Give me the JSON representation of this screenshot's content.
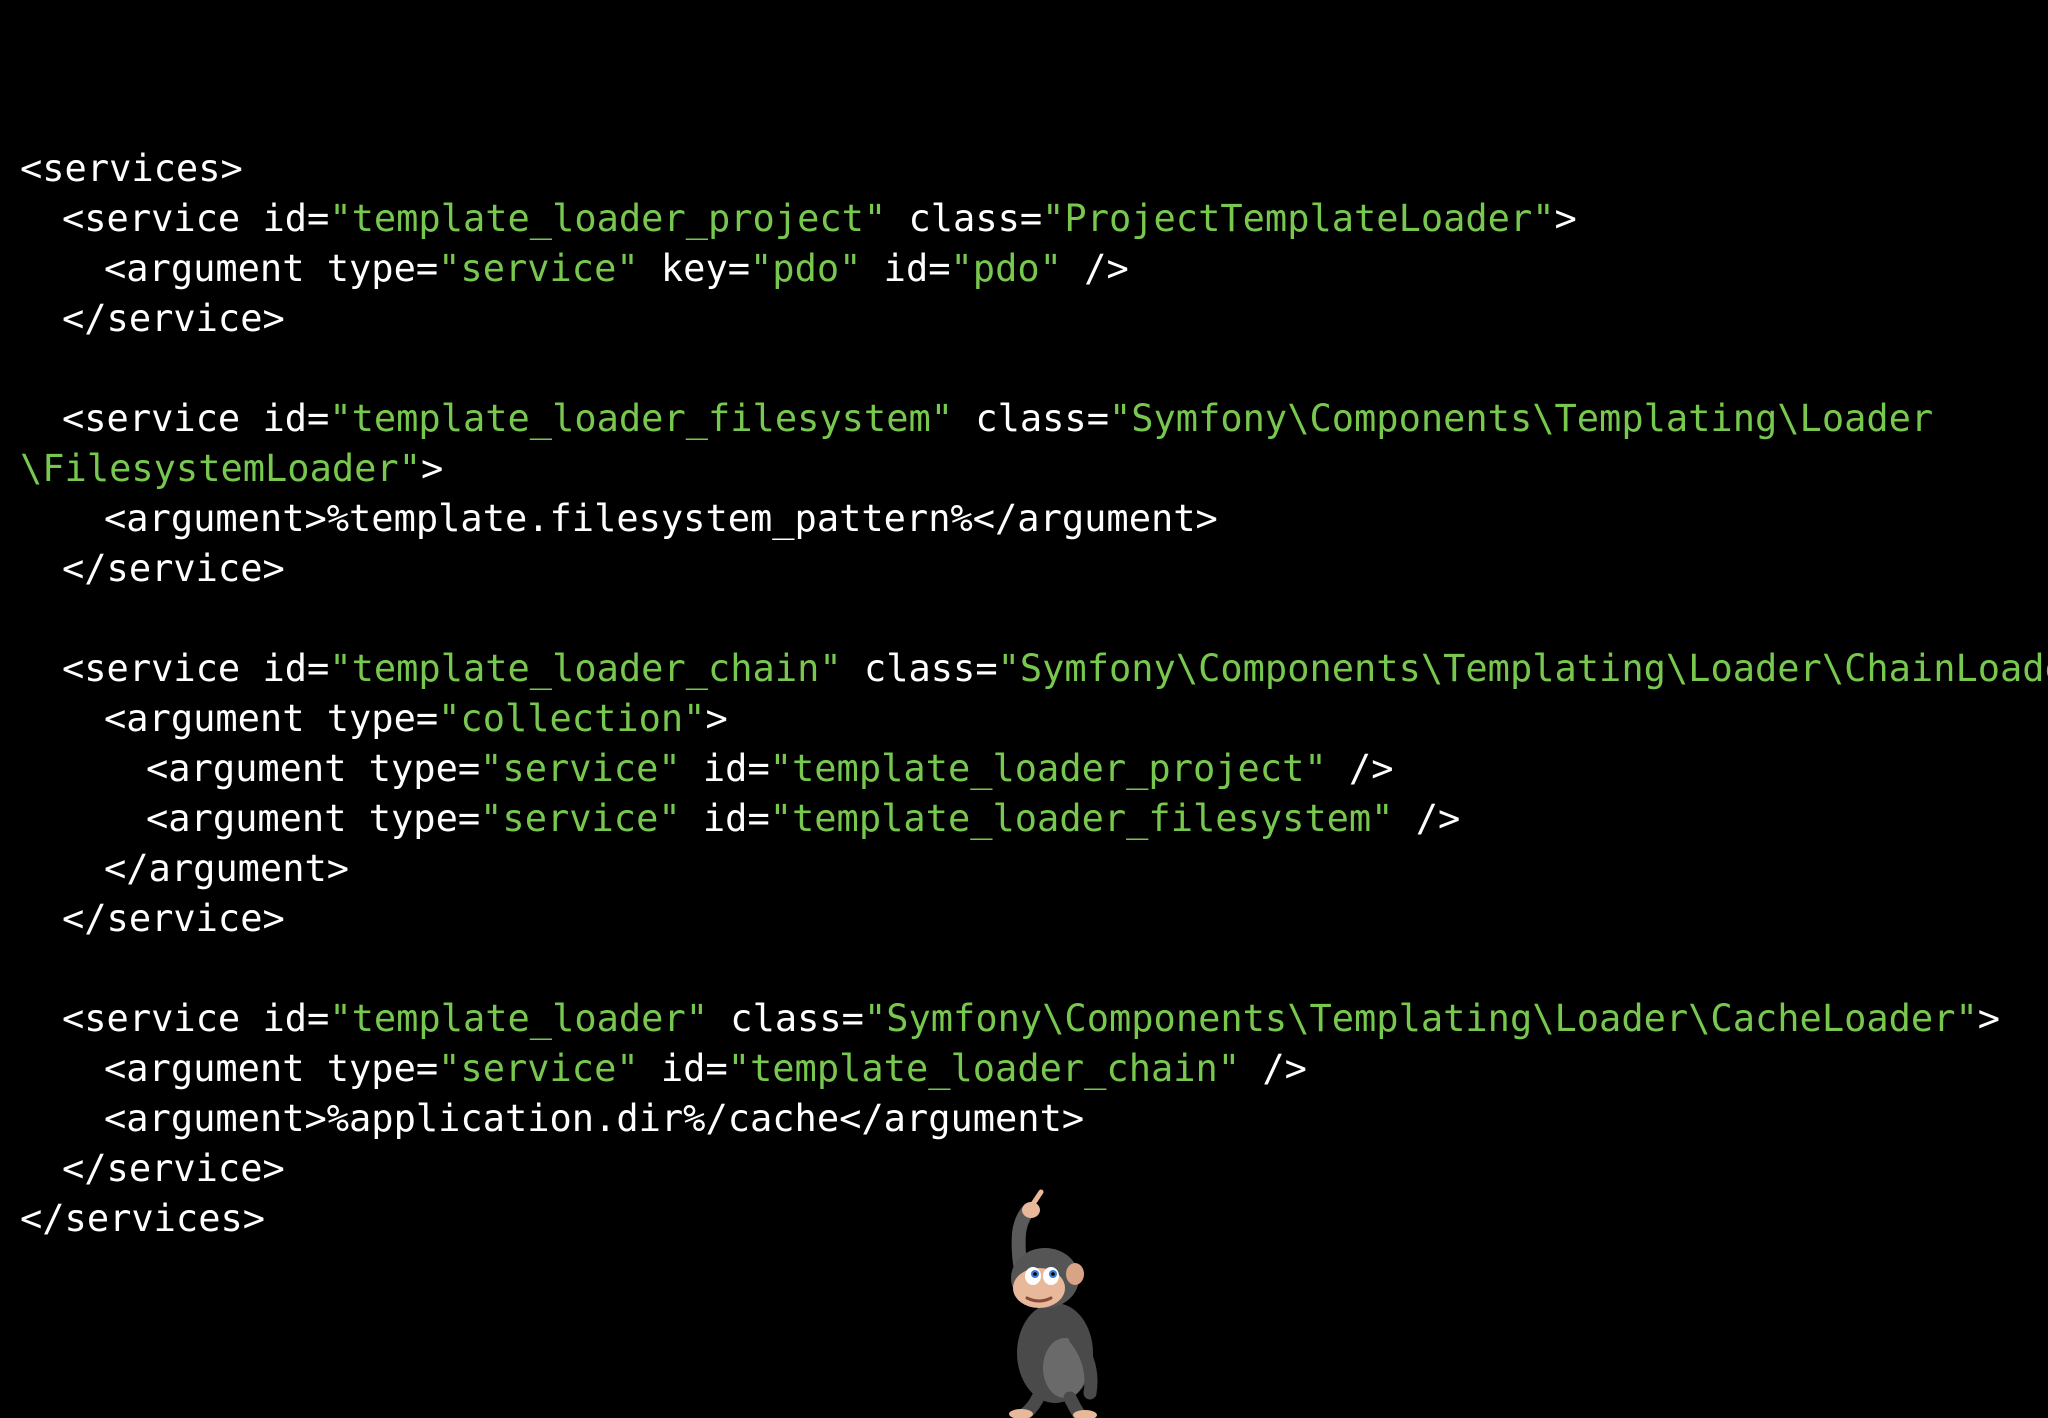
{
  "code_lines": [
    {
      "indent": 0,
      "segments": [
        {
          "t": "<services>",
          "k": "tag"
        }
      ]
    },
    {
      "indent": 1,
      "segments": [
        {
          "t": "<service id=",
          "k": "tag"
        },
        {
          "t": "\"template_loader_project\"",
          "k": "str"
        },
        {
          "t": " class=",
          "k": "tag"
        },
        {
          "t": "\"ProjectTemplateLoader\"",
          "k": "str"
        },
        {
          "t": ">",
          "k": "tag"
        }
      ]
    },
    {
      "indent": 2,
      "segments": [
        {
          "t": "<argument type=",
          "k": "tag"
        },
        {
          "t": "\"service\"",
          "k": "str"
        },
        {
          "t": " key=",
          "k": "tag"
        },
        {
          "t": "\"pdo\"",
          "k": "str"
        },
        {
          "t": " id=",
          "k": "tag"
        },
        {
          "t": "\"pdo\"",
          "k": "str"
        },
        {
          "t": " />",
          "k": "tag"
        }
      ]
    },
    {
      "indent": 1,
      "segments": [
        {
          "t": "</service>",
          "k": "tag"
        }
      ]
    },
    {
      "indent": 0,
      "segments": []
    },
    {
      "indent": 1,
      "segments": [
        {
          "t": "<service id=",
          "k": "tag"
        },
        {
          "t": "\"template_loader_filesystem\"",
          "k": "str"
        },
        {
          "t": " class=",
          "k": "tag"
        },
        {
          "t": "\"Symfony\\Components\\Templating\\Loader",
          "k": "str"
        }
      ]
    },
    {
      "indent": 0,
      "segments": [
        {
          "t": "\\FilesystemLoader\"",
          "k": "str"
        },
        {
          "t": ">",
          "k": "tag"
        }
      ]
    },
    {
      "indent": 2,
      "segments": [
        {
          "t": "<argument>%template.filesystem_pattern%</argument>",
          "k": "tag"
        }
      ]
    },
    {
      "indent": 1,
      "segments": [
        {
          "t": "</service>",
          "k": "tag"
        }
      ]
    },
    {
      "indent": 0,
      "segments": []
    },
    {
      "indent": 1,
      "segments": [
        {
          "t": "<service id=",
          "k": "tag"
        },
        {
          "t": "\"template_loader_chain\"",
          "k": "str"
        },
        {
          "t": " class=",
          "k": "tag"
        },
        {
          "t": "\"Symfony\\Components\\Templating\\Loader\\ChainLoader\"",
          "k": "str"
        },
        {
          "t": ">",
          "k": "tag"
        }
      ]
    },
    {
      "indent": 2,
      "segments": [
        {
          "t": "<argument type=",
          "k": "tag"
        },
        {
          "t": "\"collection\"",
          "k": "str"
        },
        {
          "t": ">",
          "k": "tag"
        }
      ]
    },
    {
      "indent": 3,
      "segments": [
        {
          "t": "<argument type=",
          "k": "tag"
        },
        {
          "t": "\"service\"",
          "k": "str"
        },
        {
          "t": " id=",
          "k": "tag"
        },
        {
          "t": "\"template_loader_project\"",
          "k": "str"
        },
        {
          "t": " />",
          "k": "tag"
        }
      ]
    },
    {
      "indent": 3,
      "segments": [
        {
          "t": "<argument type=",
          "k": "tag"
        },
        {
          "t": "\"service\"",
          "k": "str"
        },
        {
          "t": " id=",
          "k": "tag"
        },
        {
          "t": "\"template_loader_filesystem\"",
          "k": "str"
        },
        {
          "t": " />",
          "k": "tag"
        }
      ]
    },
    {
      "indent": 2,
      "segments": [
        {
          "t": "</argument>",
          "k": "tag"
        }
      ]
    },
    {
      "indent": 1,
      "segments": [
        {
          "t": "</service>",
          "k": "tag"
        }
      ]
    },
    {
      "indent": 0,
      "segments": []
    },
    {
      "indent": 1,
      "segments": [
        {
          "t": "<service id=",
          "k": "tag"
        },
        {
          "t": "\"template_loader\"",
          "k": "str"
        },
        {
          "t": " class=",
          "k": "tag"
        },
        {
          "t": "\"Symfony\\Components\\Templating\\Loader\\CacheLoader\"",
          "k": "str"
        },
        {
          "t": ">",
          "k": "tag"
        }
      ]
    },
    {
      "indent": 2,
      "segments": [
        {
          "t": "<argument type=",
          "k": "tag"
        },
        {
          "t": "\"service\"",
          "k": "str"
        },
        {
          "t": " id=",
          "k": "tag"
        },
        {
          "t": "\"template_loader_chain\"",
          "k": "str"
        },
        {
          "t": " />",
          "k": "tag"
        }
      ]
    },
    {
      "indent": 2,
      "segments": [
        {
          "t": "<argument>%application.dir%/cache</argument>",
          "k": "tag"
        }
      ]
    },
    {
      "indent": 1,
      "segments": [
        {
          "t": "</service>",
          "k": "tag"
        }
      ]
    },
    {
      "indent": 0,
      "segments": [
        {
          "t": "</services>",
          "k": "tag"
        }
      ]
    }
  ],
  "colors": {
    "background": "#000000",
    "tag_text": "#ffffff",
    "string_value": "#78c850"
  },
  "mascot": {
    "icon": "pointing-monkey-icon"
  }
}
